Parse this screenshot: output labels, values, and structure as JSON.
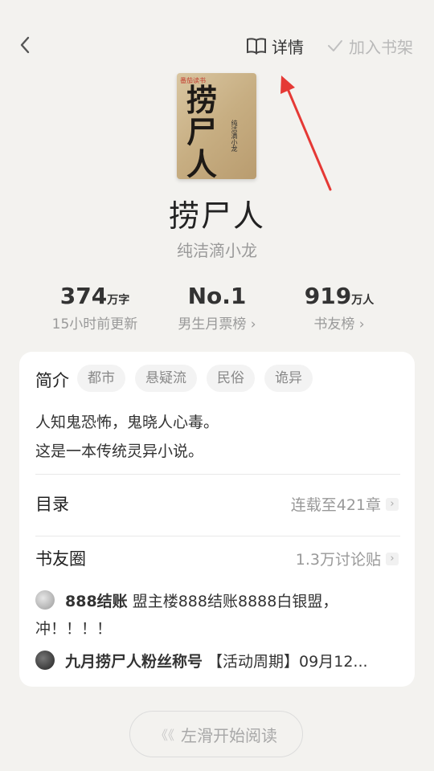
{
  "header": {
    "detail_label": "详情",
    "add_shelf_label": "加入书架"
  },
  "book": {
    "cover_publisher": "番茄读书",
    "cover_title": "捞尸人",
    "cover_subtitle": "纯洁滴小龙",
    "title": "捞尸人",
    "author": "纯洁滴小龙"
  },
  "stats": [
    {
      "value": "374",
      "unit": "万字",
      "caption": "15小时前更新"
    },
    {
      "value": "No.1",
      "unit": "",
      "caption": "男生月票榜 ›"
    },
    {
      "value": "919",
      "unit": "万人",
      "caption": "书友榜 ›"
    }
  ],
  "intro": {
    "label": "简介",
    "tags": [
      "都市",
      "悬疑流",
      "民俗",
      "诡异"
    ],
    "lines": [
      "人知鬼恐怖，鬼晓人心毒。",
      "这是一本传统灵异小说。"
    ]
  },
  "toc": {
    "label": "目录",
    "status": "连载至421章"
  },
  "circle": {
    "label": "书友圈",
    "count": "1.3万讨论贴",
    "posts": [
      {
        "name": "888结账",
        "text": " 盟主楼888结账8888白银盟，",
        "text2": "冲！！！！"
      },
      {
        "name": "九月捞尸人粉丝称号",
        "text": " 【活动周期】09月12..."
      }
    ]
  },
  "read_button": {
    "label": "左滑开始阅读",
    "arrow": "《《"
  },
  "colors": {
    "background": "#f3f2ef",
    "card": "#ffffff",
    "annotation_arrow": "#e53935"
  }
}
